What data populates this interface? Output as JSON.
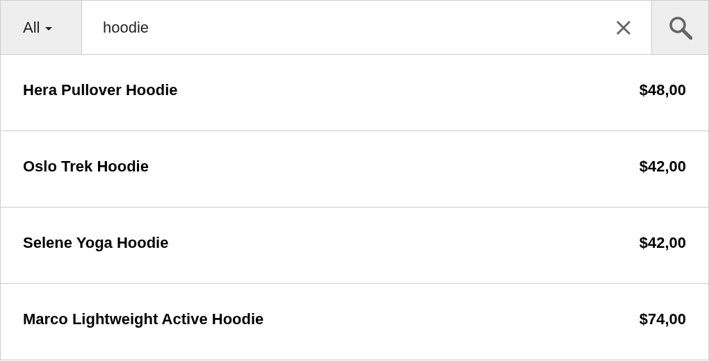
{
  "search": {
    "category": "All",
    "value": "hoodie"
  },
  "results": [
    {
      "name": "Hera Pullover Hoodie",
      "price": "$48,00"
    },
    {
      "name": "Oslo Trek Hoodie",
      "price": "$42,00"
    },
    {
      "name": "Selene Yoga Hoodie",
      "price": "$42,00"
    },
    {
      "name": "Marco Lightweight Active Hoodie",
      "price": "$74,00"
    }
  ]
}
